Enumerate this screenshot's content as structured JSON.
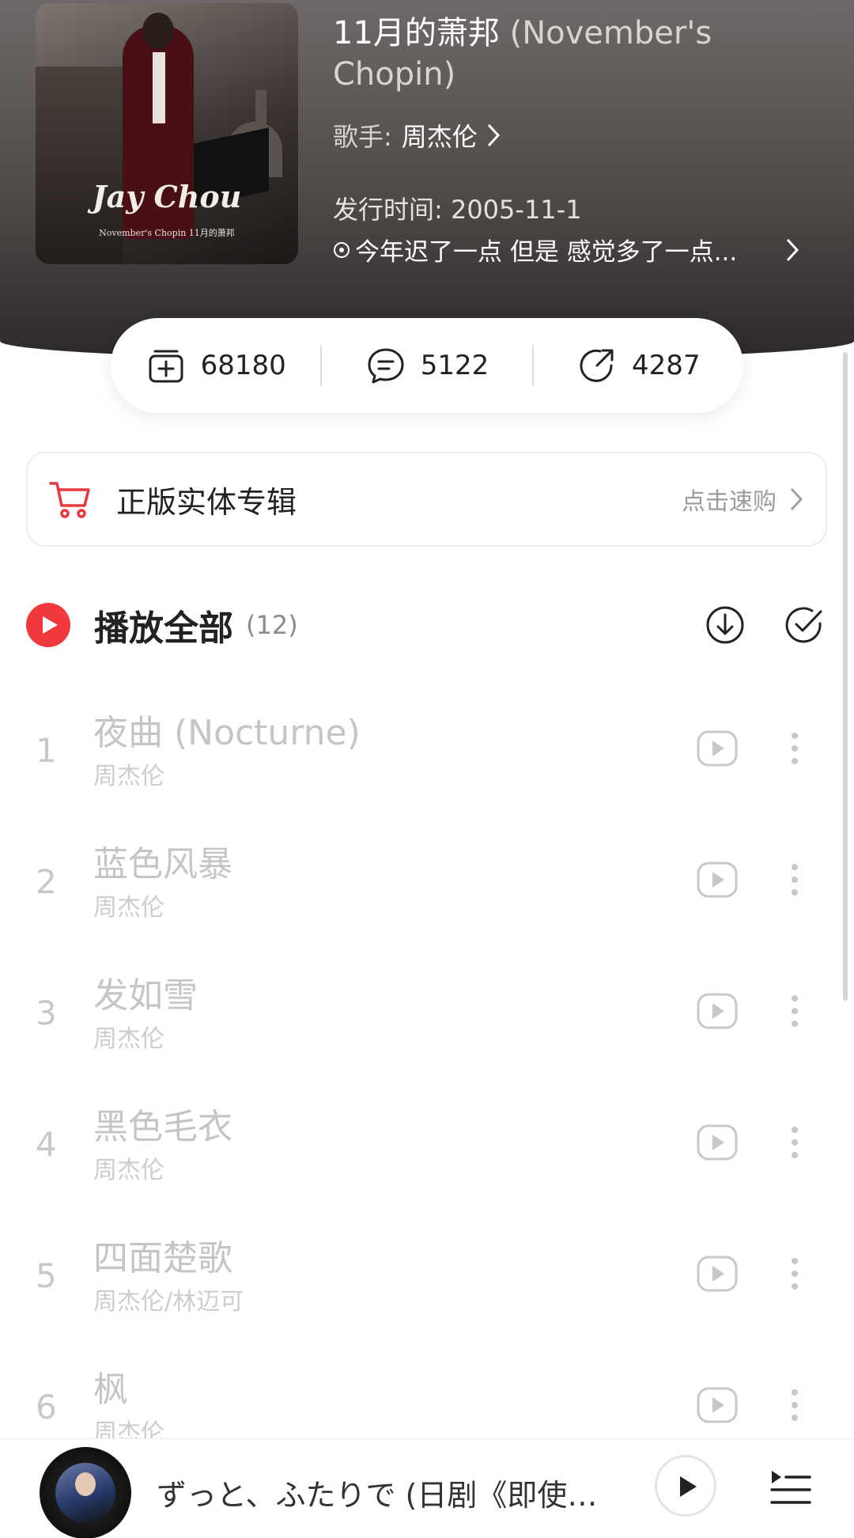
{
  "album": {
    "title_zh": "11月的萧邦",
    "title_en": "(November's Chopin)",
    "artist_label": "歌手:",
    "artist_name": "周杰伦",
    "release": "发行时间: 2005-11-1",
    "description": "今年迟了一点 但是 感觉多了一点...",
    "cover_brand": "Jay Chou",
    "cover_sub": "November's Chopin 11月的萧邦"
  },
  "stats": {
    "collect": "68180",
    "comments": "5122",
    "shares": "4287"
  },
  "purchase": {
    "label": "正版实体专辑",
    "action": "点击速购"
  },
  "play_all": {
    "title": "播放全部",
    "count": "(12)"
  },
  "songs": [
    {
      "index": "1",
      "name": "夜曲 (Nocturne)",
      "artist": "周杰伦"
    },
    {
      "index": "2",
      "name": "蓝色风暴",
      "artist": "周杰伦"
    },
    {
      "index": "3",
      "name": "发如雪",
      "artist": "周杰伦"
    },
    {
      "index": "4",
      "name": "黑色毛衣",
      "artist": "周杰伦"
    },
    {
      "index": "5",
      "name": "四面楚歌",
      "artist": "周杰伦/林迈可"
    },
    {
      "index": "6",
      "name": "枫",
      "artist": "周杰伦"
    }
  ],
  "mini_player": {
    "song_title": "ずっと、ふたりで (日剧《即使…"
  },
  "colors": {
    "accent_red": "#f0383d",
    "header_dark": "#2d2929"
  }
}
